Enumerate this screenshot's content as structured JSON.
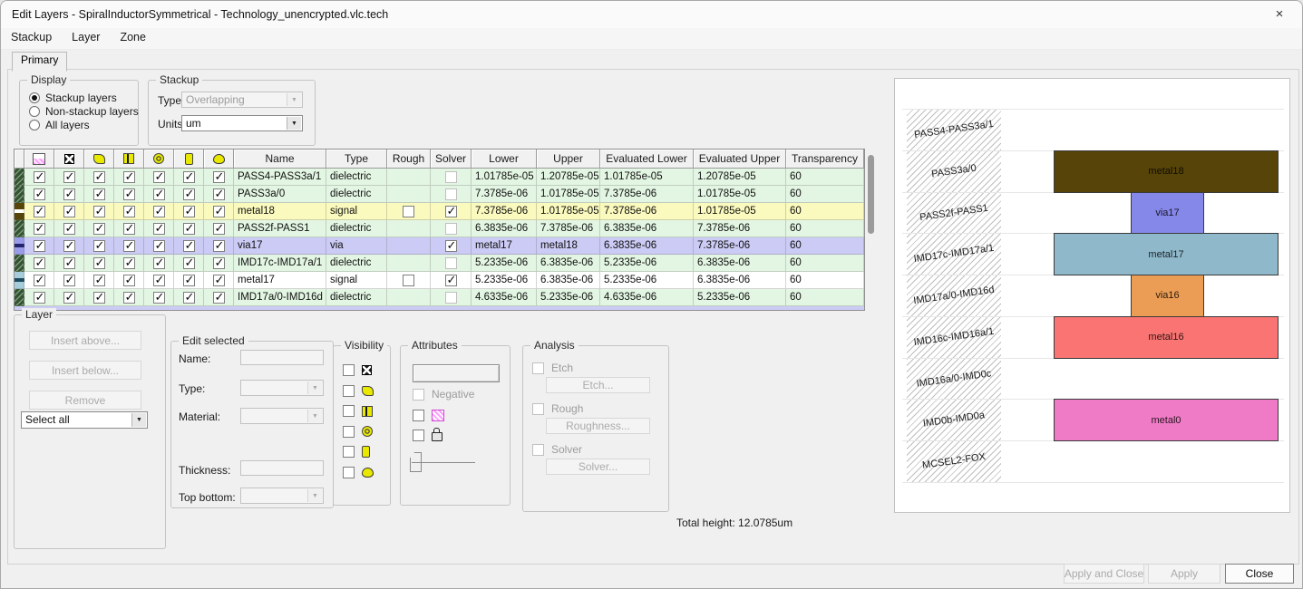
{
  "window": {
    "title": "Edit Layers - SpiralInductorSymmetrical - Technology_unencrypted.vlc.tech",
    "close_glyph": "×"
  },
  "menu_items": [
    "Stackup",
    "Layer",
    "Zone"
  ],
  "tab_label": "Primary",
  "display_group": {
    "title": "Display",
    "options": [
      {
        "label": "Stackup layers",
        "selected": true
      },
      {
        "label": "Non-stackup layers",
        "selected": false
      },
      {
        "label": "All layers",
        "selected": false
      }
    ]
  },
  "stackup_group": {
    "title": "Stackup",
    "type_label": "Type:",
    "type_value": "Overlapping",
    "units_label": "Units:",
    "units_value": "um"
  },
  "table": {
    "icon_columns": [
      "pattern-icon",
      "rect-icon",
      "polygon-icon",
      "path-icon",
      "circle-icon",
      "pin-icon",
      "bug-icon"
    ],
    "text_columns": [
      "Name",
      "Type",
      "Rough",
      "Solver",
      "Lower",
      "Upper",
      "Evaluated Lower",
      "Evaluated Upper",
      "Transparency"
    ],
    "rows": [
      {
        "name": "PASS4-PASS3a/1",
        "type": "dielectric",
        "visibility_checks": [
          true,
          true,
          true,
          true,
          true,
          true,
          true
        ],
        "rough": null,
        "solver": "unchecked",
        "lower": "1.01785e-05",
        "upper": "1.20785e-05",
        "eval_lower": "1.01785e-05",
        "eval_upper": "1.20785e-05",
        "transparency": "60",
        "bg": "#e3f6e3",
        "swatch": "dielectric"
      },
      {
        "name": "PASS3a/0",
        "type": "dielectric",
        "visibility_checks": [
          true,
          true,
          true,
          true,
          true,
          true,
          true
        ],
        "rough": null,
        "solver": "unchecked",
        "lower": "7.3785e-06",
        "upper": "1.01785e-05",
        "eval_lower": "7.3785e-06",
        "eval_upper": "1.01785e-05",
        "transparency": "60",
        "bg": "#e3f6e3",
        "swatch": "dielectric"
      },
      {
        "name": "metal18",
        "type": "signal",
        "visibility_checks": [
          true,
          true,
          true,
          true,
          true,
          true,
          true
        ],
        "rough": false,
        "solver": "checked",
        "lower": "7.3785e-06",
        "upper": "1.01785e-05",
        "eval_lower": "7.3785e-06",
        "eval_upper": "1.01785e-05",
        "transparency": "60",
        "bg": "#fafabe",
        "swatch": "metal18"
      },
      {
        "name": "PASS2f-PASS1",
        "type": "dielectric",
        "visibility_checks": [
          true,
          true,
          true,
          true,
          true,
          true,
          true
        ],
        "rough": null,
        "solver": "unchecked",
        "lower": "6.3835e-06",
        "upper": "7.3785e-06",
        "eval_lower": "6.3835e-06",
        "eval_upper": "7.3785e-06",
        "transparency": "60",
        "bg": "#e3f6e3",
        "swatch": "dielectric"
      },
      {
        "name": "via17",
        "type": "via",
        "visibility_checks": [
          true,
          true,
          true,
          true,
          true,
          true,
          true
        ],
        "rough": null,
        "solver": "checked",
        "lower": "metal17",
        "upper": "metal18",
        "eval_lower": "6.3835e-06",
        "eval_upper": "7.3785e-06",
        "transparency": "60",
        "bg": "#cbcbf5",
        "swatch": "via17"
      },
      {
        "name": "IMD17c-IMD17a/1",
        "type": "dielectric",
        "visibility_checks": [
          true,
          true,
          true,
          true,
          true,
          true,
          true
        ],
        "rough": null,
        "solver": "unchecked",
        "lower": "5.2335e-06",
        "upper": "6.3835e-06",
        "eval_lower": "5.2335e-06",
        "eval_upper": "6.3835e-06",
        "transparency": "60",
        "bg": "#e3f6e3",
        "swatch": "dielectric"
      },
      {
        "name": "metal17",
        "type": "signal",
        "visibility_checks": [
          true,
          true,
          true,
          true,
          true,
          true,
          true
        ],
        "rough": false,
        "solver": "checked",
        "lower": "5.2335e-06",
        "upper": "6.3835e-06",
        "eval_lower": "5.2335e-06",
        "eval_upper": "6.3835e-06",
        "transparency": "60",
        "bg": "#ffffff",
        "swatch": "metal17"
      },
      {
        "name": "IMD17a/0-IMD16d",
        "type": "dielectric",
        "visibility_checks": [
          true,
          true,
          true,
          true,
          true,
          true,
          true
        ],
        "rough": null,
        "solver": "unchecked",
        "lower": "4.6335e-06",
        "upper": "5.2335e-06",
        "eval_lower": "4.6335e-06",
        "eval_upper": "5.2335e-06",
        "transparency": "60",
        "bg": "#e3f6e3",
        "swatch": "dielectric"
      }
    ],
    "partial_next_row_color": "#cbcbf5"
  },
  "layer_group": {
    "title": "Layer",
    "buttons": [
      {
        "label": "Insert above...",
        "enabled": false
      },
      {
        "label": "Insert below...",
        "enabled": false
      },
      {
        "label": "Remove",
        "enabled": false
      }
    ],
    "select_value": "Select all"
  },
  "edit_selected": {
    "title": "Edit selected",
    "fields": [
      {
        "label": "Name:",
        "kind": "text",
        "value": ""
      },
      {
        "label": "Type:",
        "kind": "combo",
        "value": ""
      },
      {
        "label": "Material:",
        "kind": "combo",
        "value": ""
      },
      {
        "label": "Thickness:",
        "kind": "text",
        "value": ""
      },
      {
        "label": "Top bottom:",
        "kind": "combo",
        "value": ""
      }
    ]
  },
  "visibility_group": {
    "title": "Visibility",
    "items": [
      "rect-icon",
      "polygon-icon",
      "path-icon",
      "circle-icon",
      "pin-icon",
      "bug-icon"
    ]
  },
  "attributes_group": {
    "title": "Attributes",
    "negative_label": "Negative",
    "icon_items": [
      "pattern-icon",
      "lock-icon"
    ]
  },
  "analysis_group": {
    "title": "Analysis",
    "items": [
      {
        "check": "Etch",
        "button": "Etch..."
      },
      {
        "check": "Rough",
        "button": "Roughness..."
      },
      {
        "check": "Solver",
        "button": "Solver..."
      }
    ]
  },
  "total_height_label": "Total height: 12.0785um",
  "stack_view": {
    "rows": [
      {
        "label": "PASS4-PASS3a/1",
        "bar": null
      },
      {
        "label": "PASS3a/0",
        "bar": {
          "name": "metal18",
          "color": "#574408",
          "width": "wide"
        }
      },
      {
        "label": "PASS2f-PASS1",
        "bar": {
          "name": "via17",
          "color": "#8587e9",
          "width": "narrow"
        }
      },
      {
        "label": "IMD17c-IMD17a/1",
        "bar": {
          "name": "metal17",
          "color": "#8fb9cb",
          "width": "wide"
        }
      },
      {
        "label": "IMD17a/0-IMD16d",
        "bar": {
          "name": "via16",
          "color": "#eb9d55",
          "width": "narrow"
        }
      },
      {
        "label": "IMD16c-IMD16a/1",
        "bar": {
          "name": "metal16",
          "color": "#f97472",
          "width": "wide"
        }
      },
      {
        "label": "IMD16a/0-IMD0c",
        "bar": null
      },
      {
        "label": "IMD0b-IMD0a",
        "bar": {
          "name": "metal0",
          "color": "#ef7ac5",
          "width": "wide"
        }
      },
      {
        "label": "MCSEL2-FOX",
        "bar": null
      }
    ]
  },
  "footer_buttons": [
    {
      "label": "Apply and Close",
      "enabled": false
    },
    {
      "label": "Apply",
      "enabled": false
    },
    {
      "label": "Close",
      "enabled": true
    }
  ]
}
